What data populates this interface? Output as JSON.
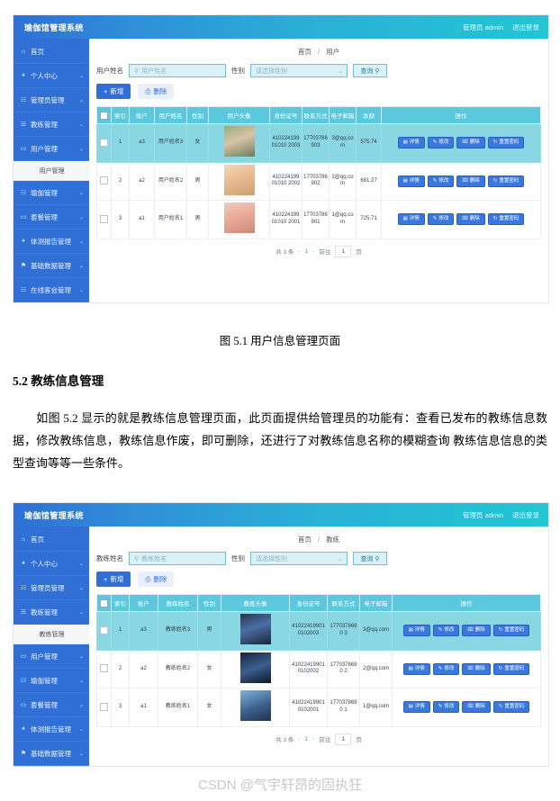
{
  "document": {
    "figure1_caption": "图 5.1  用户信息管理页面",
    "section_title": "5.2  教练信息管理",
    "paragraph": "如图 5.2 显示的就是教练信息管理页面，此页面提供给管理员的功能有：查看已发布的教练信息数据，修改教练信息，教练信息作废，即可删除，还进行了对教练信息名称的模糊查询 教练信息信息的类型查询等等一些条件。",
    "watermark": "CSDN @气宇轩昂的固执狂"
  },
  "app1": {
    "header": {
      "logo": "瑜伽馆管理系统",
      "user": "管理员 admin",
      "logout": "退出登录"
    },
    "sidebar": {
      "items": [
        {
          "label": "首页",
          "icon": "home-icon",
          "caret": "",
          "expanded": false
        },
        {
          "label": "个人中心",
          "icon": "user-icon",
          "caret": "⌄",
          "expanded": false
        },
        {
          "label": "管理员管理",
          "icon": "grid-icon",
          "caret": "⌄",
          "expanded": false
        },
        {
          "label": "教练管理",
          "icon": "bank-icon",
          "caret": "⌄",
          "expanded": false
        },
        {
          "label": "用户管理",
          "icon": "monitor-icon",
          "caret": "⌄",
          "expanded": true
        },
        {
          "label": "瑜伽管理",
          "icon": "grid-icon",
          "caret": "⌄",
          "expanded": false
        },
        {
          "label": "套餐管理",
          "icon": "monitor-icon",
          "caret": "⌄",
          "expanded": false
        },
        {
          "label": "体测报告管理",
          "icon": "user-icon",
          "caret": "⌄",
          "expanded": false
        },
        {
          "label": "基础数据管理",
          "icon": "flag-icon",
          "caret": "⌄",
          "expanded": false
        },
        {
          "label": "在线客会管理",
          "icon": "grid-icon",
          "caret": "⌄",
          "expanded": false
        }
      ],
      "sub_item": "用户管理"
    },
    "breadcrumb": {
      "root": "首页",
      "sep": "/",
      "current": "用户"
    },
    "filter": {
      "name_label": "用户姓名",
      "name_placeholder": "用户姓名",
      "name_value": "",
      "gender_label": "性别",
      "gender_placeholder": "请选择性别",
      "gender_value": "",
      "search_button": "查询",
      "search_icon": "search-icon"
    },
    "actions": {
      "add": "新增",
      "delete": "删除"
    },
    "table": {
      "columns": [
        "",
        "索引",
        "账户",
        "用户姓名",
        "性别",
        "用户头像",
        "身份证号",
        "联系方式",
        "电子邮箱",
        "余额",
        "操作"
      ],
      "rows": [
        {
          "index": "1",
          "account": "a3",
          "name": "用户姓名3",
          "gender": "女",
          "avatar": "avatar-woman-1",
          "id_card": "41022419901010 2003",
          "phone": "17703786903",
          "email": "3@qq.com",
          "balance": "575.74",
          "ops": [
            "详情",
            "修改",
            "删除",
            "重置密码"
          ],
          "highlight": true
        },
        {
          "index": "2",
          "account": "a2",
          "name": "用户姓名2",
          "gender": "男",
          "avatar": "avatar-woman-2",
          "id_card": "41022419901010 2002",
          "phone": "17703786902",
          "email": "2@qq.com",
          "balance": "681.27",
          "ops": [
            "详情",
            "修改",
            "删除",
            "重置密码"
          ],
          "highlight": false
        },
        {
          "index": "3",
          "account": "a1",
          "name": "用户姓名1",
          "gender": "男",
          "avatar": "avatar-woman-3",
          "id_card": "41022419901010 2001",
          "phone": "17703786901",
          "email": "1@qq.com",
          "balance": "725.71",
          "ops": [
            "详情",
            "修改",
            "删除",
            "重置密码"
          ],
          "highlight": false
        }
      ]
    },
    "pager": {
      "total": "共 3 条",
      "prev": "‹",
      "page": "1",
      "next": "›",
      "goto_label": "前往",
      "goto_value": "1",
      "goto_unit": "页"
    }
  },
  "app2": {
    "header": {
      "logo": "瑜伽馆管理系统",
      "user": "管理员 admin",
      "logout": "退出登录"
    },
    "sidebar": {
      "items": [
        {
          "label": "首页",
          "icon": "home-icon",
          "caret": "",
          "expanded": false
        },
        {
          "label": "个人中心",
          "icon": "user-icon",
          "caret": "⌄",
          "expanded": false
        },
        {
          "label": "管理员管理",
          "icon": "grid-icon",
          "caret": "⌄",
          "expanded": false
        },
        {
          "label": "教练管理",
          "icon": "bank-icon",
          "caret": "⌄",
          "expanded": true
        },
        {
          "label": "用户管理",
          "icon": "monitor-icon",
          "caret": "⌄",
          "expanded": false
        },
        {
          "label": "瑜伽管理",
          "icon": "grid-icon",
          "caret": "⌄",
          "expanded": false
        },
        {
          "label": "套餐管理",
          "icon": "monitor-icon",
          "caret": "⌄",
          "expanded": false
        },
        {
          "label": "体测报告管理",
          "icon": "user-icon",
          "caret": "⌄",
          "expanded": false
        },
        {
          "label": "基础数据管理",
          "icon": "flag-icon",
          "caret": "⌄",
          "expanded": false
        }
      ],
      "sub_item": "教练管理"
    },
    "breadcrumb": {
      "root": "首页",
      "sep": "/",
      "current": "教练"
    },
    "filter": {
      "name_label": "教练姓名",
      "name_placeholder": "教练姓名",
      "name_value": "",
      "gender_label": "性别",
      "gender_placeholder": "请选择性别",
      "gender_value": "",
      "search_button": "查询",
      "search_icon": "search-icon"
    },
    "actions": {
      "add": "新增",
      "delete": "删除"
    },
    "table": {
      "columns": [
        "",
        "索引",
        "账户",
        "教练姓名",
        "性别",
        "教练头像",
        "身份证号",
        "联系方式",
        "电子邮箱",
        "操作"
      ],
      "rows": [
        {
          "index": "1",
          "account": "a3",
          "name": "教练姓名3",
          "gender": "男",
          "avatar": "avatar-coach-1",
          "id_card": "410224199010102003",
          "phone": "1770378690 3",
          "email": "3@qq.com",
          "ops": [
            "详情",
            "修改",
            "删除",
            "重置密码"
          ],
          "highlight": true
        },
        {
          "index": "2",
          "account": "a2",
          "name": "教练姓名2",
          "gender": "女",
          "avatar": "avatar-coach-2",
          "id_card": "410224199010102002",
          "phone": "1770378690 2",
          "email": "2@qq.com",
          "ops": [
            "详情",
            "修改",
            "删除",
            "重置密码"
          ],
          "highlight": false
        },
        {
          "index": "3",
          "account": "a1",
          "name": "教练姓名1",
          "gender": "女",
          "avatar": "avatar-coach-3",
          "id_card": "410224199010102001",
          "phone": "1770378690 1",
          "email": "1@qq.com",
          "ops": [
            "详情",
            "修改",
            "删除",
            "重置密码"
          ],
          "highlight": false
        }
      ]
    },
    "pager": {
      "total": "共 3 条",
      "prev": "‹",
      "page": "1",
      "next": "›",
      "goto_label": "前往",
      "goto_value": "1",
      "goto_unit": "页"
    }
  },
  "colors": {
    "header_start": "#2f6fd6",
    "header_end": "#21c6d4",
    "sidebar": "#2f6fd6",
    "table_header": "#5ac8dd",
    "row_highlight": "#8ad7e4",
    "button_primary": "#2f6fd6",
    "op_button": "#3a78e0",
    "pager_active": "#24c1a8"
  }
}
